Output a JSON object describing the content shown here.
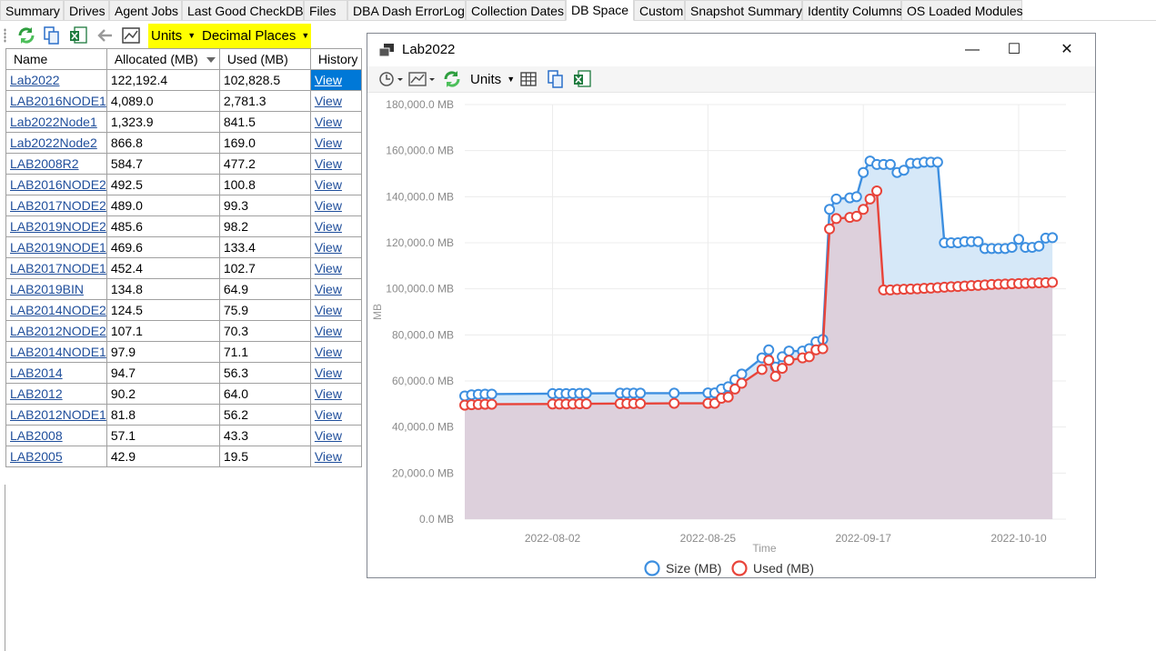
{
  "tabs": [
    "Summary",
    "Drives",
    "Agent Jobs",
    "Last Good CheckDB",
    "Files",
    "DBA Dash ErrorLog",
    "Collection Dates",
    "DB Space",
    "Custom",
    "Snapshot Summary",
    "Identity Columns",
    "OS Loaded Modules"
  ],
  "toolbar": {
    "units_label": "Units",
    "decimal_label": "Decimal Places"
  },
  "table": {
    "headers": {
      "name": "Name",
      "allocated": "Allocated (MB)",
      "used": "Used (MB)",
      "history": "History"
    },
    "rows": [
      {
        "name": "Lab2022",
        "allocated": "122,192.4",
        "used": "102,828.5",
        "history": "View"
      },
      {
        "name": "LAB2016NODE1",
        "allocated": "4,089.0",
        "used": "2,781.3",
        "history": "View"
      },
      {
        "name": "Lab2022Node1",
        "allocated": "1,323.9",
        "used": "841.5",
        "history": "View"
      },
      {
        "name": "Lab2022Node2",
        "allocated": "866.8",
        "used": "169.0",
        "history": "View"
      },
      {
        "name": "LAB2008R2",
        "allocated": "584.7",
        "used": "477.2",
        "history": "View"
      },
      {
        "name": "LAB2016NODE2",
        "allocated": "492.5",
        "used": "100.8",
        "history": "View"
      },
      {
        "name": "LAB2017NODE2",
        "allocated": "489.0",
        "used": "99.3",
        "history": "View"
      },
      {
        "name": "LAB2019NODE2",
        "allocated": "485.6",
        "used": "98.2",
        "history": "View"
      },
      {
        "name": "LAB2019NODE1",
        "allocated": "469.6",
        "used": "133.4",
        "history": "View"
      },
      {
        "name": "LAB2017NODE1",
        "allocated": "452.4",
        "used": "102.7",
        "history": "View"
      },
      {
        "name": "LAB2019BIN",
        "allocated": "134.8",
        "used": "64.9",
        "history": "View"
      },
      {
        "name": "LAB2014NODE2",
        "allocated": "124.5",
        "used": "75.9",
        "history": "View"
      },
      {
        "name": "LAB2012NODE2",
        "allocated": "107.1",
        "used": "70.3",
        "history": "View"
      },
      {
        "name": "LAB2014NODE1",
        "allocated": "97.9",
        "used": "71.1",
        "history": "View"
      },
      {
        "name": "LAB2014",
        "allocated": "94.7",
        "used": "56.3",
        "history": "View"
      },
      {
        "name": "LAB2012",
        "allocated": "90.2",
        "used": "64.0",
        "history": "View"
      },
      {
        "name": "LAB2012NODE1",
        "allocated": "81.8",
        "used": "56.2",
        "history": "View"
      },
      {
        "name": "LAB2008",
        "allocated": "57.1",
        "used": "43.3",
        "history": "View"
      },
      {
        "name": "LAB2005",
        "allocated": "42.9",
        "used": "19.5",
        "history": "View"
      }
    ]
  },
  "chart_window": {
    "title": "Lab2022",
    "units_label": "Units",
    "min_symbol": "—",
    "max_symbol": "☐",
    "close_symbol": "✕"
  },
  "chart_data": {
    "type": "area",
    "ylabel": "MB",
    "xlabel": "Time",
    "ylim": [
      0,
      180000
    ],
    "yticks": [
      0,
      20000,
      40000,
      60000,
      80000,
      100000,
      120000,
      140000,
      160000,
      180000
    ],
    "ytick_labels": [
      "0.0 MB",
      "20,000.0 MB",
      "40,000.0 MB",
      "60,000.0 MB",
      "80,000.0 MB",
      "100,000.0 MB",
      "120,000.0 MB",
      "140,000.0 MB",
      "160,000.0 MB",
      "180,000.0 MB"
    ],
    "xlim": [
      "2022-07-20",
      "2022-10-17"
    ],
    "xticks": [
      "2022-08-02",
      "2022-08-25",
      "2022-09-17",
      "2022-10-10"
    ],
    "grid": true,
    "legend_position": "bottom",
    "series": [
      {
        "name": "Size (MB)",
        "color": "#3d8fe0",
        "fill": "#d6e8f8",
        "points": [
          [
            "2022-07-20",
            53500
          ],
          [
            "2022-07-21",
            54000
          ],
          [
            "2022-07-22",
            54200
          ],
          [
            "2022-07-23",
            54300
          ],
          [
            "2022-07-24",
            54300
          ],
          [
            "2022-08-02",
            54500
          ],
          [
            "2022-08-03",
            54500
          ],
          [
            "2022-08-04",
            54500
          ],
          [
            "2022-08-05",
            54500
          ],
          [
            "2022-08-06",
            54600
          ],
          [
            "2022-08-07",
            54600
          ],
          [
            "2022-08-12",
            54700
          ],
          [
            "2022-08-13",
            54700
          ],
          [
            "2022-08-14",
            54700
          ],
          [
            "2022-08-15",
            54700
          ],
          [
            "2022-08-20",
            54700
          ],
          [
            "2022-08-25",
            54800
          ],
          [
            "2022-08-26",
            54800
          ],
          [
            "2022-08-27",
            56500
          ],
          [
            "2022-08-28",
            57500
          ],
          [
            "2022-08-29",
            60500
          ],
          [
            "2022-08-30",
            63000
          ],
          [
            "2022-09-02",
            70000
          ],
          [
            "2022-09-03",
            73500
          ],
          [
            "2022-09-04",
            66000
          ],
          [
            "2022-09-05",
            70500
          ],
          [
            "2022-09-06",
            73000
          ],
          [
            "2022-09-08",
            73000
          ],
          [
            "2022-09-09",
            74000
          ],
          [
            "2022-09-10",
            77000
          ],
          [
            "2022-09-11",
            78000
          ],
          [
            "2022-09-12",
            134500
          ],
          [
            "2022-09-13",
            139000
          ],
          [
            "2022-09-15",
            139500
          ],
          [
            "2022-09-16",
            140000
          ],
          [
            "2022-09-17",
            150500
          ],
          [
            "2022-09-18",
            155500
          ],
          [
            "2022-09-19",
            154000
          ],
          [
            "2022-09-20",
            154000
          ],
          [
            "2022-09-21",
            154000
          ],
          [
            "2022-09-22",
            150500
          ],
          [
            "2022-09-23",
            151500
          ],
          [
            "2022-09-24",
            154500
          ],
          [
            "2022-09-25",
            154500
          ],
          [
            "2022-09-26",
            155000
          ],
          [
            "2022-09-27",
            155000
          ],
          [
            "2022-09-28",
            155000
          ],
          [
            "2022-09-29",
            120000
          ],
          [
            "2022-09-30",
            120000
          ],
          [
            "2022-10-01",
            120000
          ],
          [
            "2022-10-02",
            120500
          ],
          [
            "2022-10-03",
            120500
          ],
          [
            "2022-10-04",
            120500
          ],
          [
            "2022-10-05",
            117500
          ],
          [
            "2022-10-06",
            117500
          ],
          [
            "2022-10-07",
            117500
          ],
          [
            "2022-10-08",
            117500
          ],
          [
            "2022-10-09",
            118000
          ],
          [
            "2022-10-10",
            121500
          ],
          [
            "2022-10-11",
            118000
          ],
          [
            "2022-10-12",
            118000
          ],
          [
            "2022-10-13",
            118500
          ],
          [
            "2022-10-14",
            122000
          ],
          [
            "2022-10-15",
            122200
          ]
        ]
      },
      {
        "name": "Used (MB)",
        "color": "#e8443a",
        "fill": "#ddd0dc",
        "points": [
          [
            "2022-07-20",
            49500
          ],
          [
            "2022-07-21",
            49700
          ],
          [
            "2022-07-22",
            49800
          ],
          [
            "2022-07-23",
            49900
          ],
          [
            "2022-07-24",
            49900
          ],
          [
            "2022-08-02",
            50000
          ],
          [
            "2022-08-03",
            50000
          ],
          [
            "2022-08-04",
            50000
          ],
          [
            "2022-08-05",
            50000
          ],
          [
            "2022-08-06",
            50100
          ],
          [
            "2022-08-07",
            50100
          ],
          [
            "2022-08-12",
            50200
          ],
          [
            "2022-08-13",
            50200
          ],
          [
            "2022-08-14",
            50200
          ],
          [
            "2022-08-15",
            50200
          ],
          [
            "2022-08-20",
            50300
          ],
          [
            "2022-08-25",
            50300
          ],
          [
            "2022-08-26",
            50300
          ],
          [
            "2022-08-27",
            52500
          ],
          [
            "2022-08-28",
            53000
          ],
          [
            "2022-08-29",
            56500
          ],
          [
            "2022-08-30",
            59000
          ],
          [
            "2022-09-02",
            65000
          ],
          [
            "2022-09-03",
            69000
          ],
          [
            "2022-09-04",
            62000
          ],
          [
            "2022-09-05",
            65500
          ],
          [
            "2022-09-06",
            69000
          ],
          [
            "2022-09-08",
            70000
          ],
          [
            "2022-09-09",
            70500
          ],
          [
            "2022-09-10",
            73500
          ],
          [
            "2022-09-11",
            74000
          ],
          [
            "2022-09-12",
            126000
          ],
          [
            "2022-09-13",
            130500
          ],
          [
            "2022-09-15",
            131000
          ],
          [
            "2022-09-16",
            131500
          ],
          [
            "2022-09-17",
            134500
          ],
          [
            "2022-09-18",
            139000
          ],
          [
            "2022-09-19",
            142500
          ],
          [
            "2022-09-20",
            99500
          ],
          [
            "2022-09-21",
            99500
          ],
          [
            "2022-09-22",
            99700
          ],
          [
            "2022-09-23",
            99800
          ],
          [
            "2022-09-24",
            99900
          ],
          [
            "2022-09-25",
            100000
          ],
          [
            "2022-09-26",
            100200
          ],
          [
            "2022-09-27",
            100300
          ],
          [
            "2022-09-28",
            100500
          ],
          [
            "2022-09-29",
            100700
          ],
          [
            "2022-09-30",
            100900
          ],
          [
            "2022-10-01",
            101000
          ],
          [
            "2022-10-02",
            101200
          ],
          [
            "2022-10-03",
            101400
          ],
          [
            "2022-10-04",
            101500
          ],
          [
            "2022-10-05",
            101700
          ],
          [
            "2022-10-06",
            101900
          ],
          [
            "2022-10-07",
            102000
          ],
          [
            "2022-10-08",
            102100
          ],
          [
            "2022-10-09",
            102200
          ],
          [
            "2022-10-10",
            102300
          ],
          [
            "2022-10-11",
            102400
          ],
          [
            "2022-10-12",
            102500
          ],
          [
            "2022-10-13",
            102600
          ],
          [
            "2022-10-14",
            102700
          ],
          [
            "2022-10-15",
            102828
          ]
        ]
      }
    ]
  }
}
